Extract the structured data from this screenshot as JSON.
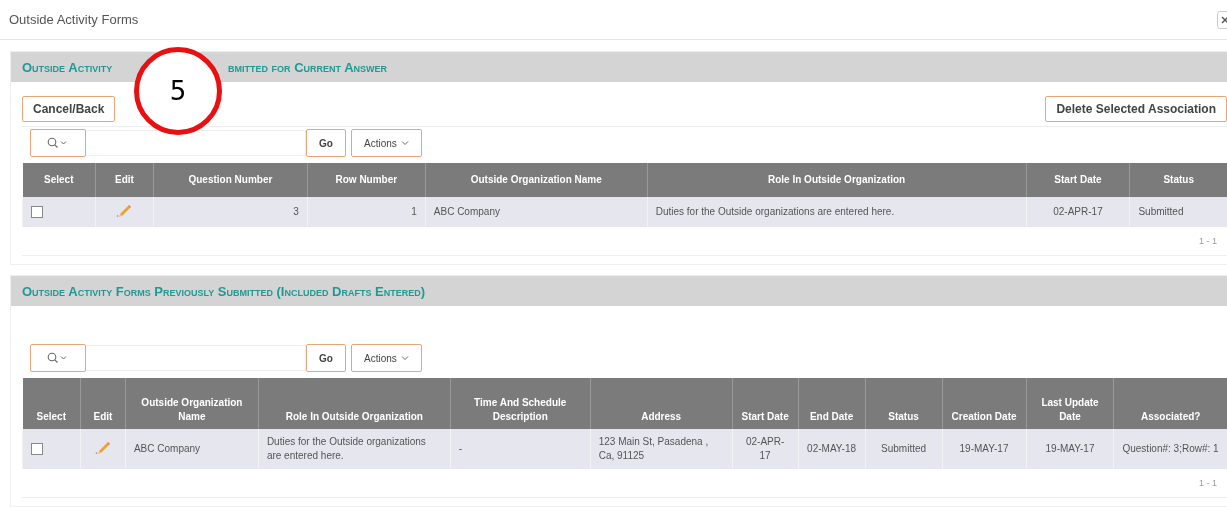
{
  "window": {
    "title": "Outside Activity Forms"
  },
  "callout": {
    "label": "5"
  },
  "regions": [
    {
      "title_parts": [
        "Outside Activity",
        "bmitted for Current Answer"
      ],
      "buttons_left": [
        "Cancel/Back"
      ],
      "buttons_right": [
        "Delete Selected Association"
      ],
      "toolbar": {
        "go": "Go",
        "actions": "Actions"
      },
      "columns": [
        "Select",
        "Edit",
        "Question Number",
        "Row Number",
        "Outside Organization Name",
        "Role In Outside Organization",
        "Start Date",
        "Status"
      ],
      "rows": [
        {
          "cells": [
            {
              "kind": "checkbox",
              "checked": false
            },
            {
              "kind": "edit"
            },
            {
              "kind": "text",
              "text": "3"
            },
            {
              "kind": "text",
              "text": "1"
            },
            {
              "kind": "text",
              "text": "ABC Company"
            },
            {
              "kind": "text",
              "text": "Duties for the Outside organizations are entered here."
            },
            {
              "kind": "text",
              "text": "02-APR-17"
            },
            {
              "kind": "text",
              "text": "Submitted"
            }
          ]
        }
      ],
      "pagination": "1 - 1"
    },
    {
      "title_parts": [
        "Outside Activity Forms Previously Submitted (Included Drafts Entered)"
      ],
      "toolbar": {
        "go": "Go",
        "actions": "Actions"
      },
      "columns": [
        "Select",
        "Edit",
        "Outside Organization Name",
        "Role In Outside Organization",
        "Time And Schedule Description",
        "Address",
        "Start Date",
        "End Date",
        "Status",
        "Creation Date",
        "Last Update Date",
        "Associated?"
      ],
      "rows": [
        {
          "cells": [
            {
              "kind": "checkbox",
              "checked": false
            },
            {
              "kind": "edit"
            },
            {
              "kind": "text",
              "text": "ABC Company"
            },
            {
              "kind": "text",
              "text": "Duties for the Outside organizations are entered here."
            },
            {
              "kind": "text",
              "text": "-"
            },
            {
              "kind": "text",
              "text": "123 Main St, Pasadena , Ca, 91125"
            },
            {
              "kind": "text",
              "text": "02-APR-17"
            },
            {
              "kind": "text",
              "text": "02-MAY-18"
            },
            {
              "kind": "text",
              "text": "Submitted"
            },
            {
              "kind": "text",
              "text": "19-MAY-17"
            },
            {
              "kind": "text",
              "text": "19-MAY-17"
            },
            {
              "kind": "text",
              "text": "Question#: 3;Row#: 1"
            }
          ]
        }
      ],
      "pagination": "1 - 1"
    }
  ]
}
